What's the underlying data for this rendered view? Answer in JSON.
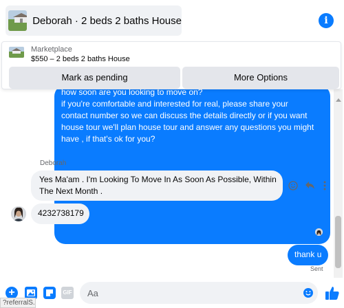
{
  "header": {
    "title": "Deborah · 2 beds 2 baths House",
    "info_icon": "info-circle-icon",
    "accent": "#0a7cff"
  },
  "listing_card": {
    "label": "Marketplace",
    "detail": "$550 – 2 beds 2 baths House",
    "pending_button": "Mark as pending",
    "options_button": "More Options"
  },
  "messages": [
    {
      "from": "me",
      "lines": [
        "how soon are you looking to move on?",
        "if you're comfortable and interested for real, please share your",
        "contact number so we can discuss the details directly or if you  want",
        "house tour we'll plan house tour and answer any questions you might",
        "have , if that's ok for you?"
      ]
    },
    {
      "from": "them",
      "sender": "Deborah",
      "text": "Yes Ma'am . I'm Looking To Move In As Soon As Possible, Within The Next Month ."
    },
    {
      "from": "them",
      "text": "4232738179"
    },
    {
      "from": "me",
      "text": "thank u",
      "status": "Sent"
    }
  ],
  "message_actions": [
    "smiley-react-icon",
    "reply-arrow-icon",
    "more-vertical-icon"
  ],
  "composer": {
    "placeholder": "Aa",
    "gif_label": "GIF",
    "tools": [
      "plus-icon",
      "photo-icon",
      "sticker-icon",
      "gif-icon",
      "emoji-icon",
      "thumbs-up-icon"
    ]
  },
  "status_bar": {
    "text": "?referralS..."
  }
}
